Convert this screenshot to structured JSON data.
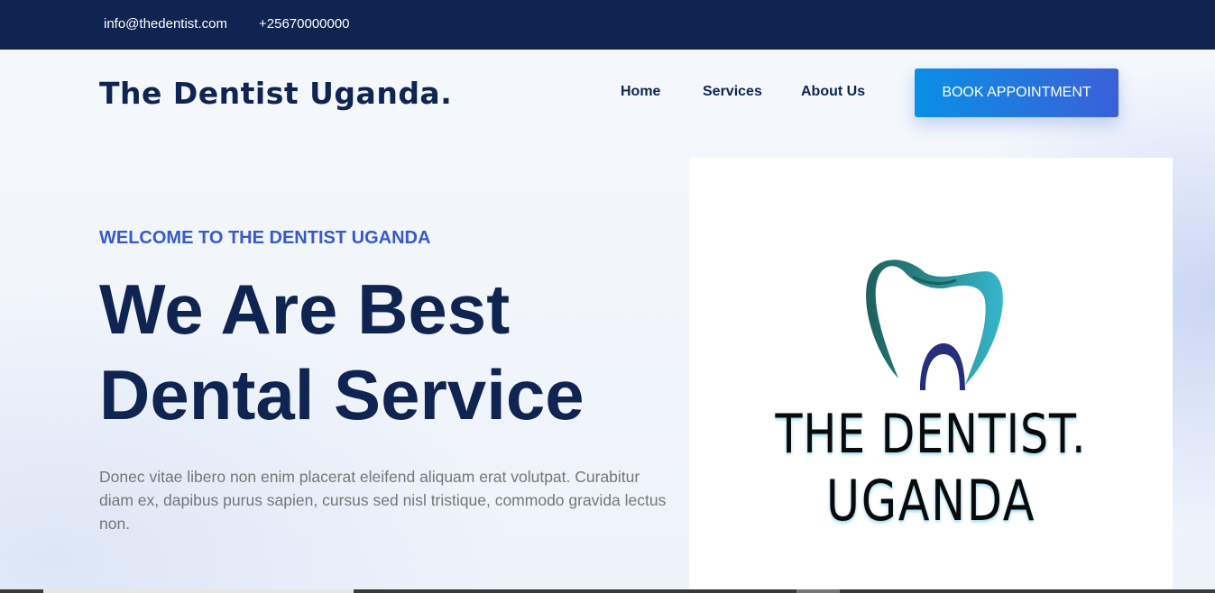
{
  "topbar": {
    "email": "info@thedentist.com",
    "phone": "+25670000000"
  },
  "header": {
    "brand": "The Dentist Uganda.",
    "nav": [
      {
        "label": "Home"
      },
      {
        "label": "Services"
      },
      {
        "label": "About Us"
      }
    ],
    "cta_label": "BOOK APPOINTMENT"
  },
  "hero": {
    "eyebrow": "WELCOME TO THE DENTIST UGANDA",
    "headline_line1": "We Are Best",
    "headline_line2": "Dental Service",
    "description": "Donec vitae libero non enim placerat eleifend aliquam erat volutpat. Curabitur diam ex, dapibus purus sapien, cursus sed nisl tristique, commodo gravida lectus non."
  },
  "logo": {
    "line1": "THE DENTIST.",
    "line2": "UGANDA",
    "icon": "tooth-logo-icon"
  },
  "colors": {
    "navy": "#0f2451",
    "accent": "#3759cc",
    "button_start": "#0a8fe6",
    "button_end": "#3a60d8"
  }
}
